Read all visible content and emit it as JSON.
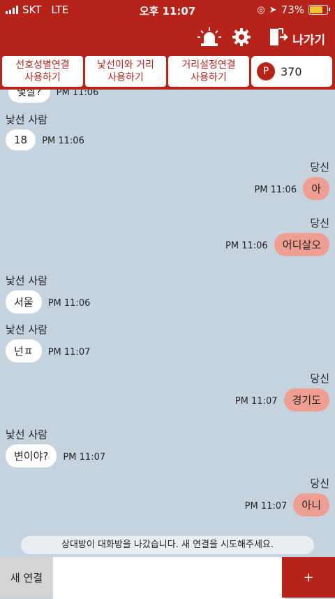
{
  "status": {
    "carrier": "SKT",
    "network": "LTE",
    "time": "오후 11:07",
    "battery": "73%"
  },
  "header": {
    "exit_label": "나가기"
  },
  "tabs": [
    {
      "line1": "선호성별연결",
      "line2": "사용하기"
    },
    {
      "line1": "낯선이와 거리",
      "line2": "사용하기"
    },
    {
      "line1": "거리설정연결",
      "line2": "사용하기"
    }
  ],
  "points": {
    "badge": "P",
    "value": "370"
  },
  "messages": [
    {
      "sender": "",
      "text": "몇살?",
      "time": "PM 11:06"
    },
    {
      "sender": "낯선 사람",
      "text": "18",
      "time": "PM 11:06"
    },
    {
      "sender": "당신",
      "text": "아",
      "time": "PM 11:06"
    },
    {
      "sender": "당신",
      "text": "어디살오",
      "time": "PM 11:06"
    },
    {
      "sender": "낯선 사람",
      "text": "서울",
      "time": "PM 11:06"
    },
    {
      "sender": "낯선 사람",
      "text": "넌ㅍ",
      "time": "PM 11:07"
    },
    {
      "sender": "당신",
      "text": "경기도",
      "time": "PM 11:07"
    },
    {
      "sender": "낯선 사람",
      "text": "변이야?",
      "time": "PM 11:07"
    },
    {
      "sender": "당신",
      "text": "아니",
      "time": "PM 11:07"
    }
  ],
  "notice": "상대방이 대화방을 나갔습니다. 새 연결을 시도해주세요.",
  "footer": {
    "new_connection": "새 연결",
    "input_value": "",
    "send_label": "+"
  },
  "colors": {
    "brand": "#b72319",
    "chat_bg": "#c5d3df",
    "my_bubble": "#ee9f92"
  }
}
